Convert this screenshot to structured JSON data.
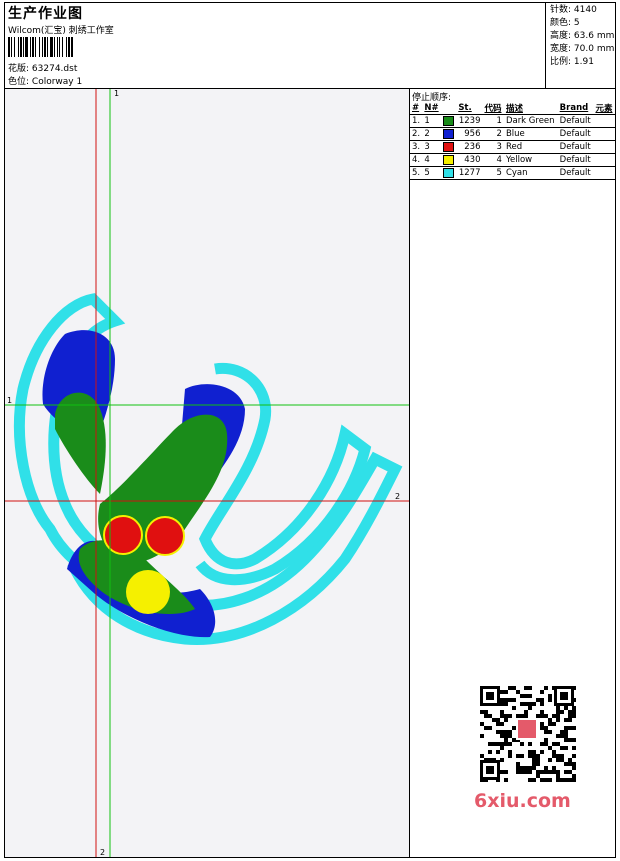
{
  "header": {
    "title": "生产作业图",
    "company": "Wilcom(汇宝) 刺绣工作室",
    "design_label": "花版:",
    "design_value": "63274.dst",
    "colorway_label": "色位:",
    "colorway_value": "Colorway 1"
  },
  "stats": [
    {
      "label": "针数:",
      "value": "4140"
    },
    {
      "label": "颜色:",
      "value": "5"
    },
    {
      "label": "高度:",
      "value": "63.6 mm"
    },
    {
      "label": "宽度:",
      "value": "70.0 mm"
    },
    {
      "label": "比例:",
      "value": "1.91"
    }
  ],
  "sequence": {
    "title": "停止顺序:",
    "headers": [
      "#",
      "N#",
      "St.",
      "代码",
      "描述",
      "Brand",
      "元素"
    ],
    "rows": [
      {
        "idx": "1.",
        "n": "1",
        "color": "#1a8c1a",
        "st": "1239",
        "code": "1",
        "desc": "Dark Green",
        "brand": "Default"
      },
      {
        "idx": "2.",
        "n": "2",
        "color": "#1020d0",
        "st": "956",
        "code": "2",
        "desc": "Blue",
        "brand": "Default"
      },
      {
        "idx": "3.",
        "n": "3",
        "color": "#e01010",
        "st": "236",
        "code": "3",
        "desc": "Red",
        "brand": "Default"
      },
      {
        "idx": "4.",
        "n": "4",
        "color": "#f5f000",
        "st": "430",
        "code": "4",
        "desc": "Yellow",
        "brand": "Default"
      },
      {
        "idx": "5.",
        "n": "5",
        "color": "#30e0e8",
        "st": "1277",
        "code": "5",
        "desc": "Cyan",
        "brand": "Default"
      }
    ]
  },
  "axes": {
    "green_top": "1",
    "green_left": "1",
    "red_right": "2",
    "red_bottom": "2"
  },
  "watermark": {
    "text": "6xiu.com",
    "stamp": "刺绣图库"
  },
  "colors": {
    "dark_green": "#1a8c1a",
    "blue": "#1020d0",
    "red": "#e01010",
    "yellow": "#f5f000",
    "cyan": "#30e0e8",
    "guide_red": "#d01010",
    "guide_green": "#10c010"
  }
}
